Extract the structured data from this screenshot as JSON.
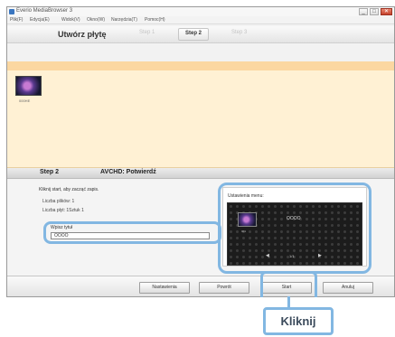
{
  "window": {
    "title": "Everio MediaBrowser 3",
    "menu": [
      "Plik(F)",
      "Edycja(E)",
      "Widok(V)",
      "Okno(W)",
      "Narzędzia(T)",
      "Pomoc(H)"
    ],
    "controls": {
      "minimize": "_",
      "maximize": "□",
      "close": "✕"
    }
  },
  "stepbar": {
    "section_title": "Utwórz płytę",
    "steps": [
      "Step 1",
      "Step 2",
      "Step 3"
    ],
    "active_step_index": 1
  },
  "thumbnails": [
    {
      "caption": "000HE"
    }
  ],
  "step2": {
    "number": "Step 2",
    "title": "AVCHD: Potwierdź"
  },
  "content": {
    "instruction": "Kliknij start, aby zacząć zapis.",
    "info_files": "Liczba plików: 1",
    "info_discs": "Liczba płyt: 1Sztuk 1",
    "title_label": "Wpisz tytuł",
    "title_value": "OOOO",
    "menu_settings_label": "Ustawienia menu:",
    "preview_title": "OOOO",
    "preview_thumb_caption": "001",
    "preview_page": "1/1",
    "icons": {
      "prev": "◀",
      "next": "▶"
    }
  },
  "footer": {
    "buttons": [
      "Nastawienia",
      "Powrót",
      "Start",
      "Anuluj"
    ]
  },
  "callout": {
    "label": "Kliknij"
  },
  "colors": {
    "highlight": "#82b7e2",
    "accent_orange": "#fbd7a1",
    "thumb_area": "#fff1d4"
  }
}
